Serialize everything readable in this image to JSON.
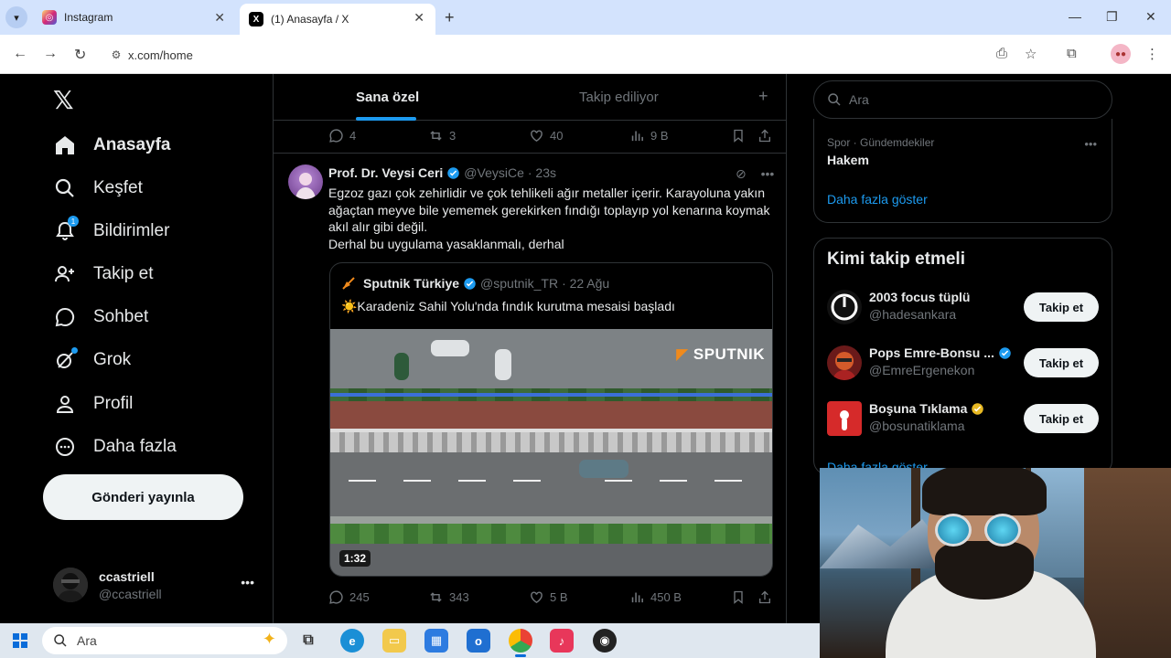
{
  "browser": {
    "tabs": [
      {
        "title": "Instagram",
        "icon": "instagram-icon"
      },
      {
        "title": "(1) Anasayfa / X",
        "icon": "x-logo-icon"
      }
    ],
    "url": "x.com/home"
  },
  "sidebar": {
    "items": [
      {
        "label": "Anasayfa",
        "icon": "home-icon"
      },
      {
        "label": "Keşfet",
        "icon": "search-icon"
      },
      {
        "label": "Bildirimler",
        "icon": "bell-icon",
        "badge": "1"
      },
      {
        "label": "Takip et",
        "icon": "follow-icon"
      },
      {
        "label": "Sohbet",
        "icon": "chat-icon"
      },
      {
        "label": "Grok",
        "icon": "grok-icon"
      },
      {
        "label": "Profil",
        "icon": "profile-icon"
      },
      {
        "label": "Daha fazla",
        "icon": "more-circle-icon"
      }
    ],
    "post_button": "Gönderi yayınla",
    "account": {
      "name": "ccastriell",
      "handle": "@ccastriell"
    }
  },
  "timeline": {
    "tabs": [
      "Sana özel",
      "Takip ediliyor"
    ],
    "prev_post_actions": {
      "replies": "4",
      "reposts": "3",
      "likes": "40",
      "views": "9 B"
    },
    "tweet": {
      "author": "Prof. Dr. Veysi Ceri",
      "handle": "@VeysiCe",
      "time": "· 23s",
      "text_line1": "Egzoz gazı çok zehirlidir ve çok tehlikeli ağır metaller içerir. Karayoluna yakın ağaçtan meyve bile yememek gerekirken fındığı toplayıp yol kenarına koymak akıl alır gibi değil.",
      "text_line2": "Derhal bu uygulama yasaklanmalı, derhal",
      "quote": {
        "author": "Sputnik Türkiye",
        "handle": "@sputnik_TR",
        "time": "· 22 Ağu",
        "text": "☀️Karadeniz Sahil Yolu'nda fındık kurutma mesaisi başladı",
        "video_logo": "SPUTNIK",
        "video_duration": "1:32"
      },
      "actions": {
        "replies": "245",
        "reposts": "343",
        "likes": "5 B",
        "views": "450 B"
      }
    }
  },
  "right": {
    "search_placeholder": "Ara",
    "trend": {
      "category": "Spor · Gündemdekiler",
      "name": "Hakem"
    },
    "show_more": "Daha fazla göster",
    "who_to_follow_title": "Kimi takip etmeli",
    "suggestions": [
      {
        "name": "2003 focus tüplü",
        "handle": "@hadesankara",
        "verified": ""
      },
      {
        "name": "Pops Emre-Bonsu ...",
        "handle": "@EmreErgenekon",
        "verified": "blue"
      },
      {
        "name": "Boşuna Tıklama",
        "handle": "@bosunatiklama",
        "verified": "gold"
      }
    ],
    "follow_label": "Takip et",
    "show_more_2": "Daha fazla göster"
  },
  "taskbar": {
    "search_placeholder": "Ara"
  },
  "colors": {
    "accent": "#1d9bf0",
    "background": "#000000",
    "text": "#e7e9ea",
    "muted": "#71767b"
  }
}
